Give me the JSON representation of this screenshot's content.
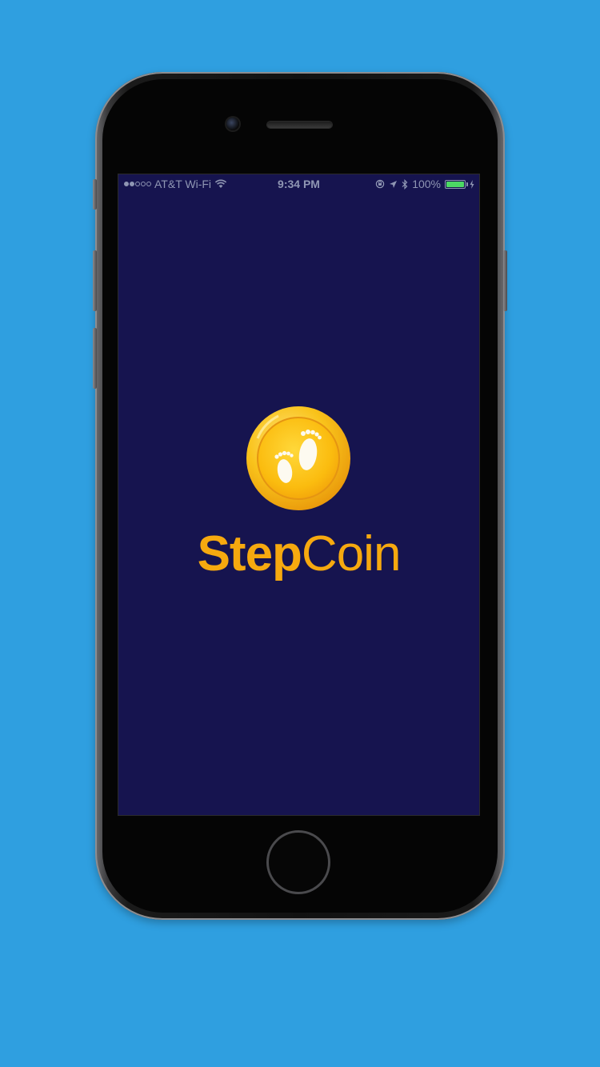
{
  "status_bar": {
    "carrier": "AT&T Wi-Fi",
    "time": "9:34 PM",
    "battery_percent": "100%",
    "battery_level": 1.0,
    "signal_bars_filled": 2,
    "signal_bars_total": 5
  },
  "app": {
    "brand_part1": "Step",
    "brand_part2": "Coin",
    "logo_icon": "footprints-coin-icon"
  },
  "colors": {
    "background": "#2f9fe0",
    "screen_background": "#16144f",
    "brand": "#f6a90f",
    "battery": "#4cd964"
  }
}
